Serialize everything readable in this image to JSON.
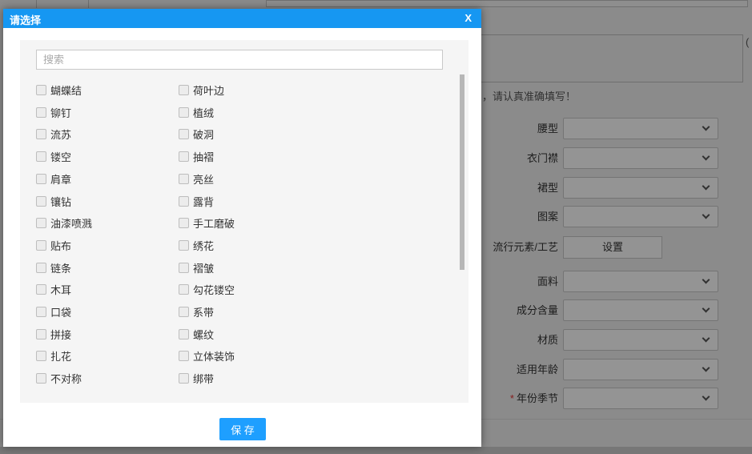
{
  "modal": {
    "title": "请选择",
    "close_label": "X",
    "search_placeholder": "搜索",
    "items": [
      "蝴蝶结",
      "荷叶边",
      "铆钉",
      "植绒",
      "流苏",
      "破洞",
      "镂空",
      "抽褶",
      "肩章",
      "亮丝",
      "镶钻",
      "露背",
      "油漆喷溅",
      "手工磨破",
      "贴布",
      "绣花",
      "链条",
      "褶皱",
      "木耳",
      "勾花镂空",
      "口袋",
      "系带",
      "拼接",
      "螺纹",
      "扎花",
      "立体装饰",
      "不对称",
      "绑带"
    ],
    "save_label": "保 存"
  },
  "background": {
    "notice": "，请认真准确填写！",
    "paren_fragment": "(",
    "fields": [
      {
        "label": "腰型",
        "name": "waist-type",
        "type": "select",
        "required": false
      },
      {
        "label": "衣门襟",
        "name": "placket",
        "type": "select",
        "required": false
      },
      {
        "label": "裙型",
        "name": "skirt-type",
        "type": "select",
        "required": false
      },
      {
        "label": "图案",
        "name": "pattern",
        "type": "select",
        "required": false
      },
      {
        "label": "流行元素/工艺",
        "name": "popular-elements-craft",
        "type": "button",
        "button_label": "设置",
        "required": false
      },
      {
        "label": "面料",
        "name": "fabric",
        "type": "select",
        "required": false
      },
      {
        "label": "成分含量",
        "name": "composition-content",
        "type": "select",
        "required": false
      },
      {
        "label": "材质",
        "name": "material",
        "type": "select",
        "required": false
      },
      {
        "label": "适用年龄",
        "name": "applicable-age",
        "type": "select",
        "required": false
      },
      {
        "label": "年份季节",
        "name": "year-season",
        "type": "select",
        "required": true
      }
    ]
  },
  "colors": {
    "accent": "#1E9FFF",
    "header_blue": "#1697f2",
    "required_red": "#e53535"
  }
}
